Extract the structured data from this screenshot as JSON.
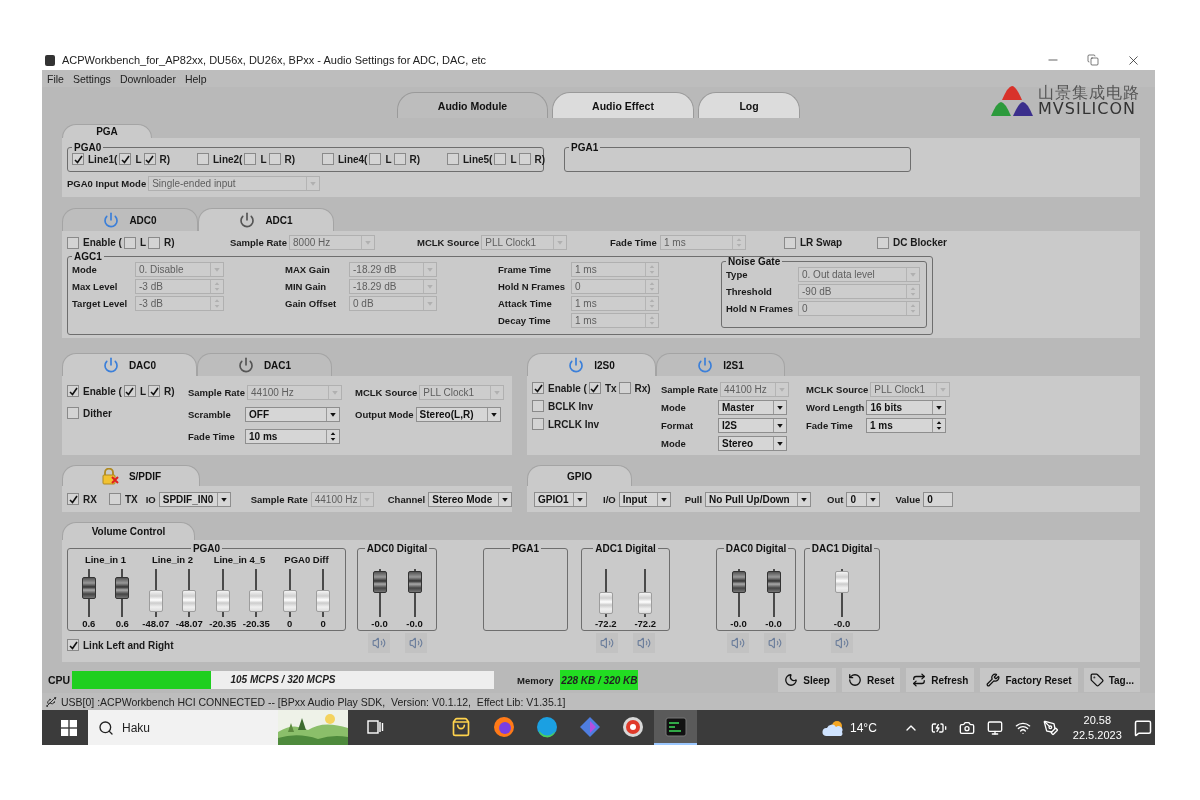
{
  "window": {
    "title": "ACPWorkbench_for_AP82xx, DU56x, DU26x, BPxx - Audio Settings for ADC, DAC, etc"
  },
  "menu": [
    "File",
    "Settings",
    "Downloader",
    "Help"
  ],
  "main_tabs": [
    {
      "label": "Audio Module",
      "selected": true
    },
    {
      "label": "Audio Effect",
      "selected": false
    },
    {
      "label": "Log",
      "selected": false
    }
  ],
  "logo": {
    "name_cn": "山景集成电路",
    "name_en": "MVSILICON"
  },
  "pga": {
    "tab": "PGA",
    "pga0": {
      "title": "PGA0",
      "lines": [
        {
          "label": "Line1(",
          "checked": true,
          "channels": [
            {
              "label": "L",
              "checked": true
            },
            {
              "label": "R)",
              "checked": true
            }
          ]
        },
        {
          "label": "Line2(",
          "checked": false,
          "channels": [
            {
              "label": "L",
              "checked": false
            },
            {
              "label": "R)",
              "checked": false
            }
          ]
        },
        {
          "label": "Line4(",
          "checked": false,
          "channels": [
            {
              "label": "L",
              "checked": false
            },
            {
              "label": "R)",
              "checked": false
            }
          ]
        },
        {
          "label": "Line5(",
          "checked": false,
          "channels": [
            {
              "label": "L",
              "checked": false
            },
            {
              "label": "R)",
              "checked": false
            }
          ]
        }
      ]
    },
    "pga1": {
      "title": "PGA1"
    },
    "input_mode": {
      "label": "PGA0 Input Mode",
      "value": "Single-ended input",
      "kind": "combo",
      "disabled": true
    }
  },
  "adc": {
    "tabs": [
      {
        "label": "ADC0",
        "selected": false,
        "on": true
      },
      {
        "label": "ADC1",
        "selected": true,
        "on": false
      }
    ],
    "enable": {
      "label": "Enable (",
      "checked": false,
      "channels": [
        {
          "label": "L",
          "checked": false
        },
        {
          "label": "R)",
          "checked": false
        }
      ]
    },
    "fields": [
      {
        "label": "Sample Rate",
        "value": "8000 Hz",
        "kind": "combo",
        "disabled": true
      },
      {
        "label": "MCLK Source",
        "value": "PLL Clock1",
        "kind": "combo",
        "disabled": true
      },
      {
        "label": "Fade Time",
        "value": "1 ms",
        "kind": "spin",
        "disabled": true
      }
    ],
    "options": [
      {
        "label": "LR Swap",
        "checked": false
      },
      {
        "label": "DC Blocker",
        "checked": false
      }
    ],
    "agc": {
      "title": "AGC1",
      "columns": [
        [
          {
            "label": "Mode",
            "value": "0. Disable",
            "kind": "combo",
            "disabled": true
          },
          {
            "label": "Max Level",
            "value": "-3 dB",
            "kind": "spin",
            "disabled": true
          },
          {
            "label": "Target Level",
            "value": "-3 dB",
            "kind": "spin",
            "disabled": true
          }
        ],
        [
          {
            "label": "MAX Gain",
            "value": "-18.29 dB",
            "kind": "combo",
            "disabled": true
          },
          {
            "label": "MIN Gain",
            "value": "-18.29 dB",
            "kind": "combo",
            "disabled": true
          },
          {
            "label": "Gain Offset",
            "value": "0 dB",
            "kind": "combo",
            "disabled": true
          }
        ],
        [
          {
            "label": "Frame Time",
            "value": "1 ms",
            "kind": "spin",
            "disabled": true
          },
          {
            "label": "Hold N Frames",
            "value": "0",
            "kind": "spin",
            "disabled": true
          },
          {
            "label": "Attack Time",
            "value": "1 ms",
            "kind": "spin",
            "disabled": true
          },
          {
            "label": "Decay Time",
            "value": "1 ms",
            "kind": "spin",
            "disabled": true
          }
        ]
      ],
      "noise_gate": {
        "title": "Noise Gate",
        "fields": [
          {
            "label": "Type",
            "value": "0. Out data level",
            "kind": "combo",
            "disabled": true
          },
          {
            "label": "Threshold",
            "value": "-90 dB",
            "kind": "spin",
            "disabled": true
          },
          {
            "label": "Hold N Frames",
            "value": "0",
            "kind": "spin",
            "disabled": true
          }
        ]
      }
    }
  },
  "dac": {
    "tabs": [
      {
        "label": "DAC0",
        "selected": true,
        "on": true
      },
      {
        "label": "DAC1",
        "selected": false,
        "on": false
      }
    ],
    "enable": {
      "label": "Enable (",
      "checked": true,
      "channels": [
        {
          "label": "L",
          "checked": true
        },
        {
          "label": "R)",
          "checked": true
        }
      ]
    },
    "options": [
      {
        "label": "Dither",
        "checked": false
      }
    ],
    "columns": [
      [
        {
          "label": "Sample Rate",
          "value": "44100 Hz",
          "kind": "combo",
          "disabled": true
        },
        {
          "label": "Scramble",
          "value": "OFF",
          "kind": "combo",
          "disabled": false
        },
        {
          "label": "Fade Time",
          "value": "10 ms",
          "kind": "spin",
          "disabled": false
        }
      ],
      [
        {
          "label": "MCLK Source",
          "value": "PLL Clock1",
          "kind": "combo",
          "disabled": true
        },
        {
          "label": "Output Mode",
          "value": "Stereo(L,R)",
          "kind": "combo",
          "disabled": false
        }
      ]
    ]
  },
  "i2s": {
    "tabs": [
      {
        "label": "I2S0",
        "selected": true,
        "on": true
      },
      {
        "label": "I2S1",
        "selected": false,
        "on": true
      }
    ],
    "enable": {
      "label": "Enable (",
      "checked": true,
      "channels": [
        {
          "label": "Tx",
          "checked": true
        },
        {
          "label": "Rx)",
          "checked": false
        }
      ]
    },
    "options": [
      {
        "label": "BCLK Inv",
        "checked": false
      },
      {
        "label": "LRCLK Inv",
        "checked": false
      }
    ],
    "columns": [
      [
        {
          "label": "Sample Rate",
          "value": "44100 Hz",
          "kind": "combo",
          "disabled": true
        },
        {
          "label": "Mode",
          "value": "Master",
          "kind": "combo",
          "disabled": false
        },
        {
          "label": "Format",
          "value": "I2S",
          "kind": "combo",
          "disabled": false
        },
        {
          "label": "Mode",
          "value": "Stereo",
          "kind": "combo",
          "disabled": false
        }
      ],
      [
        {
          "label": "MCLK Source",
          "value": "PLL Clock1",
          "kind": "combo",
          "disabled": true
        },
        {
          "label": "Word Length",
          "value": "16 bits",
          "kind": "combo",
          "disabled": false
        },
        {
          "label": "Fade Time",
          "value": "1 ms",
          "kind": "spin",
          "disabled": false
        }
      ]
    ]
  },
  "spdif": {
    "tab": "S/PDIF",
    "controls": [
      {
        "kind": "checkbox",
        "label": "RX",
        "checked": true
      },
      {
        "kind": "checkbox",
        "label": "TX",
        "checked": false
      },
      {
        "kind": "combo",
        "label": "IO",
        "value": "SPDIF_IN0",
        "disabled": false
      },
      {
        "kind": "combo",
        "label": "Sample Rate",
        "value": "44100 Hz",
        "disabled": true
      },
      {
        "kind": "combo",
        "label": "Channel",
        "value": "Stereo Mode",
        "disabled": false
      }
    ]
  },
  "gpio": {
    "tab": "GPIO",
    "controls": [
      {
        "kind": "combo",
        "value": "GPIO1",
        "disabled": false
      },
      {
        "kind": "combo",
        "label": "I/O",
        "value": "Input",
        "disabled": false
      },
      {
        "kind": "combo",
        "label": "Pull",
        "value": "No Pull Up/Down",
        "disabled": false
      },
      {
        "kind": "combo",
        "label": "Out",
        "value": "0",
        "disabled": false
      },
      {
        "kind": "text",
        "label": "Value",
        "value": "0",
        "disabled": false
      }
    ]
  },
  "volume": {
    "tab": "Volume Control",
    "groups": [
      {
        "title": "PGA0",
        "kind": "pga",
        "subgroups": [
          {
            "title": "Line_in 1",
            "sliders": [
              {
                "level": 0.71,
                "active": true,
                "value": "0.6"
              },
              {
                "level": 0.71,
                "active": true,
                "value": "0.6"
              }
            ]
          },
          {
            "title": "Line_in 2",
            "sliders": [
              {
                "level": 0.18,
                "active": false,
                "value": "-48.07"
              },
              {
                "level": 0.18,
                "active": false,
                "value": "-48.07"
              }
            ]
          },
          {
            "title": "Line_in 4_5",
            "sliders": [
              {
                "level": 0.18,
                "active": false,
                "value": "-20.35"
              },
              {
                "level": 0.18,
                "active": false,
                "value": "-20.35"
              }
            ]
          },
          {
            "title": "PGA0 Diff",
            "sliders": [
              {
                "level": 0.18,
                "active": false,
                "value": "0"
              },
              {
                "level": 0.18,
                "active": false,
                "value": "0"
              }
            ]
          }
        ]
      },
      {
        "title": "ADC0 Digital",
        "kind": "digital",
        "sliders": [
          {
            "level": 0.93,
            "active": true,
            "value": "-0.0"
          },
          {
            "level": 0.93,
            "active": true,
            "value": "-0.0"
          }
        ]
      },
      {
        "title": "PGA1",
        "kind": "digital"
      },
      {
        "title": "ADC1 Digital",
        "kind": "digital",
        "sliders": [
          {
            "level": 0.1,
            "active": false,
            "value": "-72.2"
          },
          {
            "level": 0.1,
            "active": false,
            "value": "-72.2"
          }
        ]
      },
      {
        "title": "DAC0 Digital",
        "kind": "digital",
        "sliders": [
          {
            "level": 0.93,
            "active": true,
            "value": "-0.0"
          },
          {
            "level": 0.93,
            "active": true,
            "value": "-0.0"
          }
        ]
      },
      {
        "title": "DAC1 Digital",
        "kind": "digital",
        "sliders": [
          {
            "level": 0.93,
            "active": false,
            "value": "-0.0"
          }
        ]
      }
    ],
    "link": {
      "label": "Link Left and Right",
      "checked": true
    }
  },
  "cpu": {
    "label": "CPU",
    "level": 0.33,
    "text": "105 MCPS / 320 MCPS"
  },
  "memory": {
    "label": "Memory",
    "text": "228 KB / 320 KB"
  },
  "buttons": [
    "Sleep",
    "Reset",
    "Refresh",
    "Factory Reset",
    "Tag..."
  ],
  "status_line": "USB[0] :ACPWorkbench HCI CONNECTED -- [BPxx Audio Play SDK,  Version: V0.1.12,  Effect Lib: V1.35.1]",
  "taskbar": {
    "search": {
      "placeholder": "Haku"
    },
    "apps": [
      {
        "selected": false
      },
      {
        "selected": false
      },
      {
        "selected": false
      },
      {
        "selected": false
      },
      {
        "selected": false
      },
      {
        "selected": false
      },
      {
        "selected": true
      }
    ],
    "weather": "14°C",
    "time": "20.58",
    "date": "22.5.2023"
  }
}
